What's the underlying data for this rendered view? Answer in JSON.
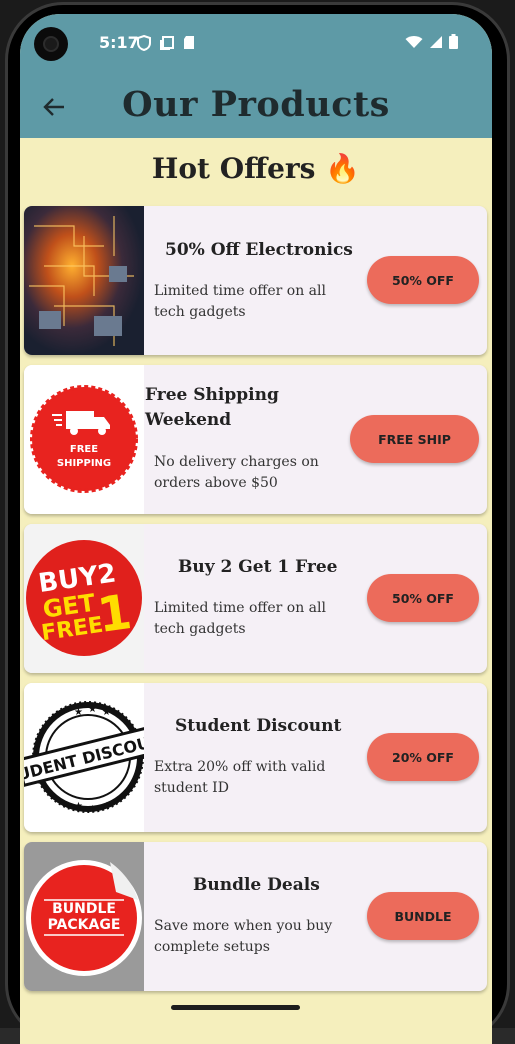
{
  "status_bar": {
    "time": "5:17"
  },
  "app_bar": {
    "title": "Our Products"
  },
  "section": {
    "title": "Hot Offers 🔥"
  },
  "offers": [
    {
      "title": "50% Off Electronics",
      "description": "Limited time offer on all tech gadgets",
      "button": "50% OFF",
      "image": "circuit-board-image"
    },
    {
      "title": "Free Shipping Weekend",
      "description": "No delivery charges on orders above $50",
      "button": "FREE SHIP",
      "image": "free-shipping-badge",
      "badge_text": "FREE SHIPPING"
    },
    {
      "title": "Buy 2 Get 1 Free",
      "description": "Limited time offer on all tech gadgets",
      "button": "50% OFF",
      "image": "buy2-get1-free-badge",
      "badge_text": "BUY2 GET FREE 1"
    },
    {
      "title": "Student Discount",
      "description": "Extra 20% off with valid student ID",
      "button": "20% OFF",
      "image": "student-discount-stamp",
      "badge_text": "STUDENT DISCOUNT"
    },
    {
      "title": "Bundle Deals",
      "description": "Save more when you buy complete setups",
      "button": "BUNDLE",
      "image": "bundle-package-sticker",
      "badge_text": "BUNDLE PACKAGE"
    }
  ],
  "colors": {
    "app_bar": "#5e9aa6",
    "background": "#f5efbd",
    "card": "#f5f0f6",
    "button": "#ec6b5b"
  }
}
